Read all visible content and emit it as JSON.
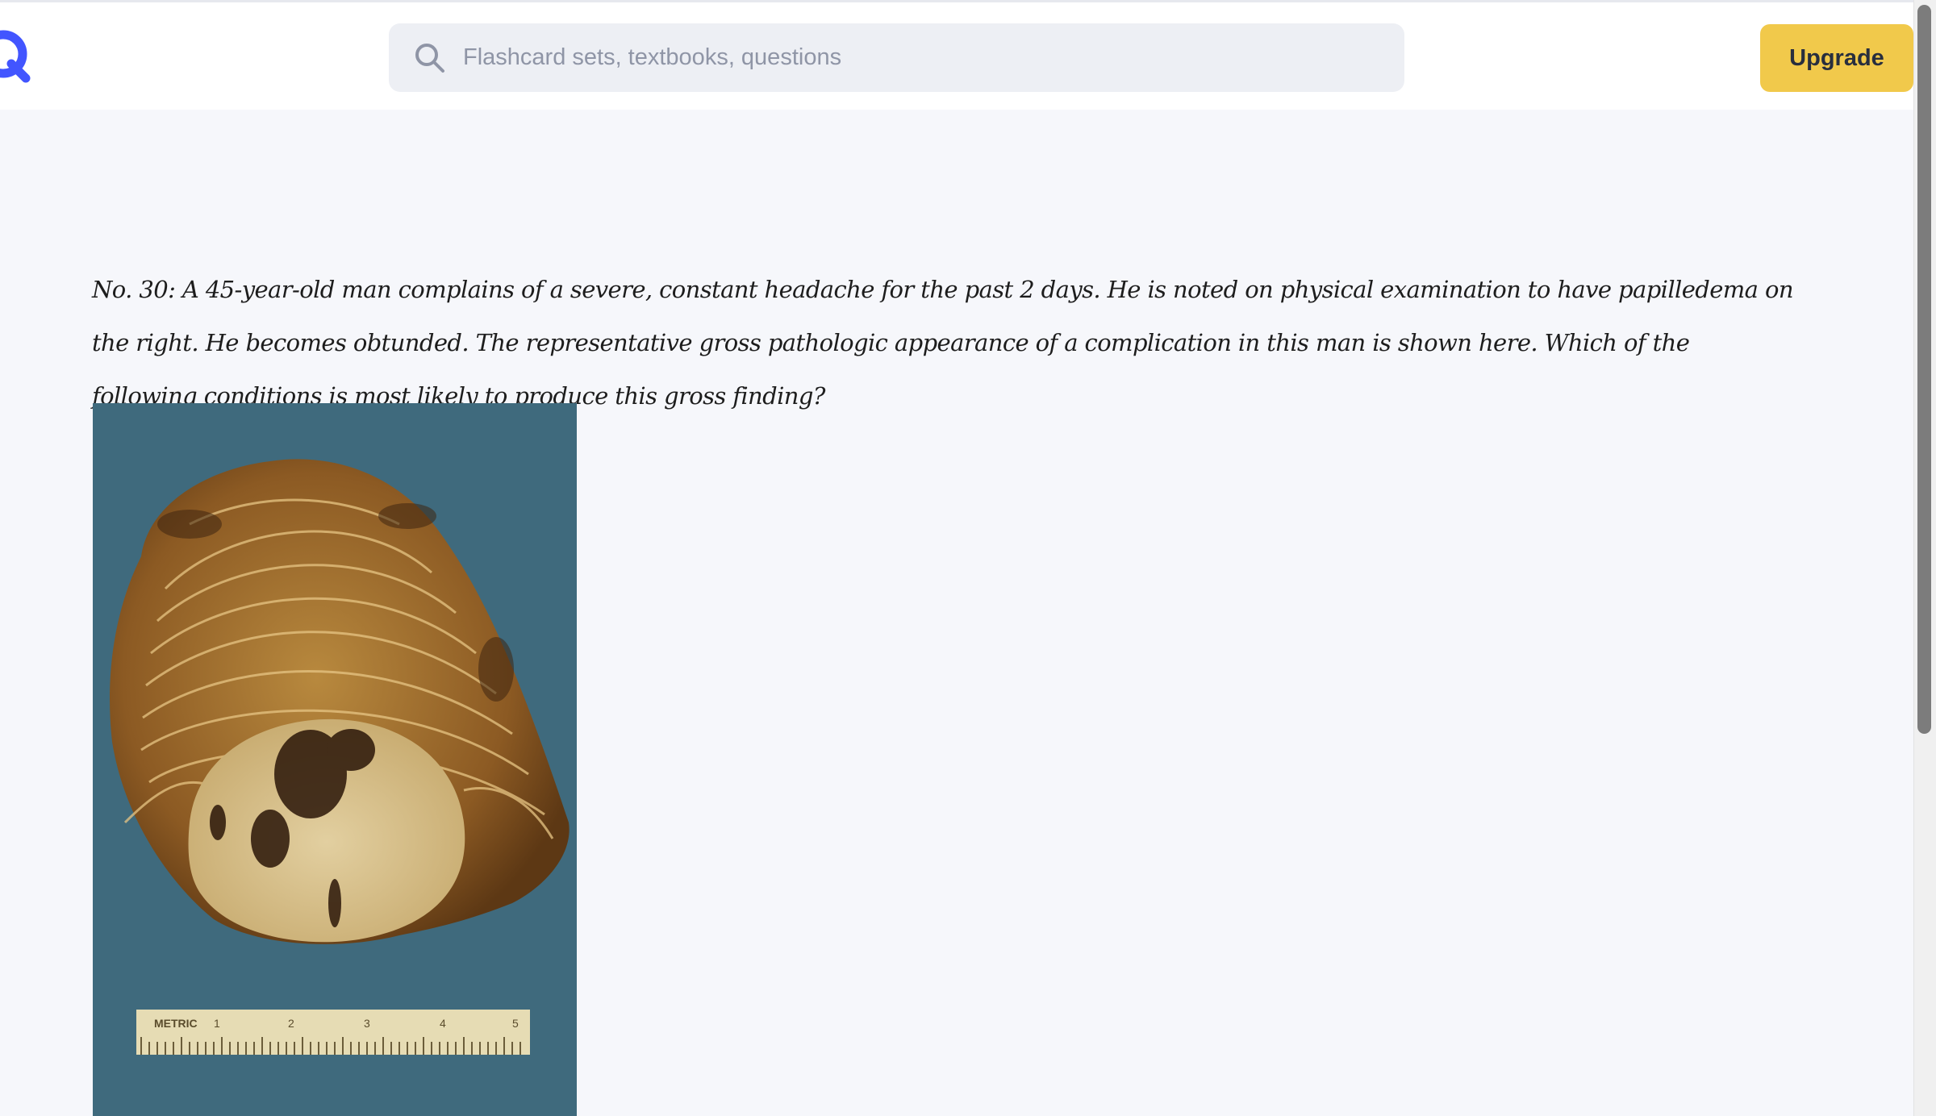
{
  "header": {
    "search": {
      "placeholder": "Flashcard sets, textbooks, questions"
    },
    "upgrade_label": "Upgrade",
    "icons": {
      "logo": "quizlet-q-logo",
      "search": "search-icon"
    }
  },
  "content": {
    "question_text": "No. 30: A 45-year-old man complains of a severe, constant headache for the past 2 days. He is noted on physical examination to have papilledema on the right. He becomes obtunded. The representative gross pathologic appearance of a complication in this man is shown here. Which of the following conditions is most likely to produce this gross finding?",
    "figure": {
      "ruler_label": "METRIC",
      "ruler_marks": [
        "1",
        "2",
        "3",
        "4",
        "5"
      ]
    }
  },
  "colors": {
    "brand": "#4255ff",
    "upgrade": "#f1c94b",
    "figure_background": "#3f6a7d"
  }
}
